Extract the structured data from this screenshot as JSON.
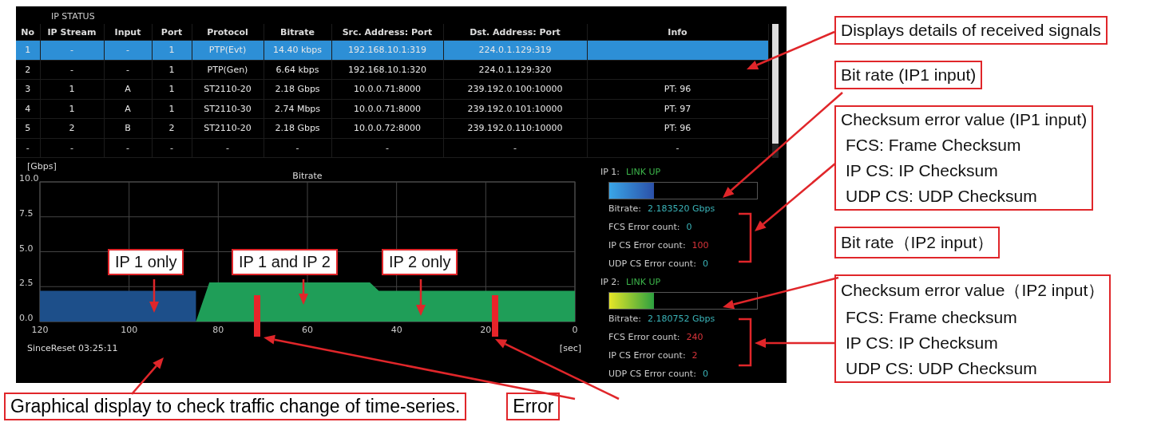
{
  "screen": {
    "title": "IP STATUS",
    "table": {
      "columns": [
        "No",
        "IP Stream",
        "Input",
        "Port",
        "Protocol",
        "Bitrate",
        "Src. Address: Port",
        "Dst. Address: Port",
        "Info"
      ],
      "rows": [
        {
          "selected": true,
          "cells": [
            "1",
            "-",
            "-",
            "1",
            "PTP(Evt)",
            "14.40 kbps",
            "192.168.10.1:319",
            "224.0.1.129:319",
            ""
          ]
        },
        {
          "selected": false,
          "cells": [
            "2",
            "-",
            "-",
            "1",
            "PTP(Gen)",
            "6.64 kbps",
            "192.168.10.1:320",
            "224.0.1.129:320",
            ""
          ]
        },
        {
          "selected": false,
          "cells": [
            "3",
            "1",
            "A",
            "1",
            "ST2110-20",
            "2.18 Gbps",
            "10.0.0.71:8000",
            "239.192.0.100:10000",
            "PT: 96"
          ]
        },
        {
          "selected": false,
          "cells": [
            "4",
            "1",
            "A",
            "1",
            "ST2110-30",
            "2.74 Mbps",
            "10.0.0.71:8000",
            "239.192.0.101:10000",
            "PT: 97"
          ]
        },
        {
          "selected": false,
          "cells": [
            "5",
            "2",
            "B",
            "2",
            "ST2110-20",
            "2.18 Gbps",
            "10.0.0.72:8000",
            "239.192.0.110:10000",
            "PT: 96"
          ]
        },
        {
          "selected": false,
          "cells": [
            "-",
            "-",
            "-",
            "-",
            "-",
            "-",
            "-",
            "-",
            "-"
          ]
        }
      ]
    },
    "chart_data": {
      "type": "area",
      "title": "Bitrate",
      "ylabel": "[Gbps]",
      "xlabel": "[sec]",
      "x": [
        120,
        110,
        100,
        90,
        85,
        82,
        80,
        70,
        60,
        50,
        46,
        44,
        40,
        30,
        20,
        10,
        0
      ],
      "series": [
        {
          "color": "#1d4f8a",
          "values": [
            2.2,
            2.2,
            2.2,
            2.2,
            2.2,
            null,
            null,
            null,
            null,
            null,
            null,
            null,
            null,
            null,
            null,
            null,
            null
          ]
        },
        {
          "color": "#1f9e58",
          "values": [
            null,
            null,
            null,
            null,
            0,
            2.8,
            2.8,
            2.8,
            2.8,
            2.8,
            2.8,
            2.2,
            2.2,
            2.2,
            2.2,
            2.2,
            2.2
          ]
        }
      ],
      "xlim": [
        120,
        0
      ],
      "ylim": [
        0,
        10
      ],
      "grid": true,
      "xticks": [
        120,
        100,
        80,
        60,
        40,
        20,
        0
      ],
      "yticks": [
        {
          "value": 0,
          "label": "0.0"
        },
        {
          "value": 2.5,
          "label": "2.5"
        },
        {
          "value": 5,
          "label": "5.0"
        },
        {
          "value": 7.5,
          "label": "7.5"
        },
        {
          "value": 10,
          "label": "10.0"
        }
      ]
    },
    "since_reset": "SinceReset 03:25:11",
    "ports": [
      {
        "label": "IP 1:",
        "link": "LINK UP",
        "kind": "blue",
        "level": 0.3,
        "bitrate_label": "Bitrate:",
        "bitrate": "2.183520 Gbps",
        "counts": [
          {
            "label": "FCS Error count:",
            "value": "0",
            "alert": false
          },
          {
            "label": "IP CS Error count:",
            "value": "100",
            "alert": true
          },
          {
            "label": "UDP CS Error count:",
            "value": "0",
            "alert": false
          }
        ]
      },
      {
        "label": "IP 2:",
        "link": "LINK UP",
        "kind": "yellow",
        "level": 0.3,
        "bitrate_label": "Bitrate:",
        "bitrate": "2.180752 Gbps",
        "counts": [
          {
            "label": "FCS Error count:",
            "value": "240",
            "alert": true
          },
          {
            "label": "IP CS Error count:",
            "value": "2",
            "alert": true
          },
          {
            "label": "UDP CS Error count:",
            "value": "0",
            "alert": false
          }
        ]
      }
    ]
  },
  "chart_callouts": [
    "IP 1 only",
    "IP 1 and IP 2",
    "IP 2 only"
  ],
  "side_callouts": [
    {
      "title": "Displays details of received signals"
    },
    {
      "title": "Bit rate (IP1 input)"
    },
    {
      "title": "Checksum error value (IP1 input)",
      "lines": [
        "FCS: Frame Checksum",
        "IP CS: IP Checksum",
        "UDP CS: UDP Checksum"
      ]
    },
    {
      "title": "Bit rate（IP2 input）"
    },
    {
      "title": "Checksum error value（IP2 input）",
      "lines": [
        "FCS: Frame checksum",
        "IP CS: IP Checksum",
        "UDP CS: UDP Checksum"
      ]
    }
  ],
  "bottom_callouts": [
    "Graphical display to check traffic change of time-series.",
    "Error"
  ]
}
